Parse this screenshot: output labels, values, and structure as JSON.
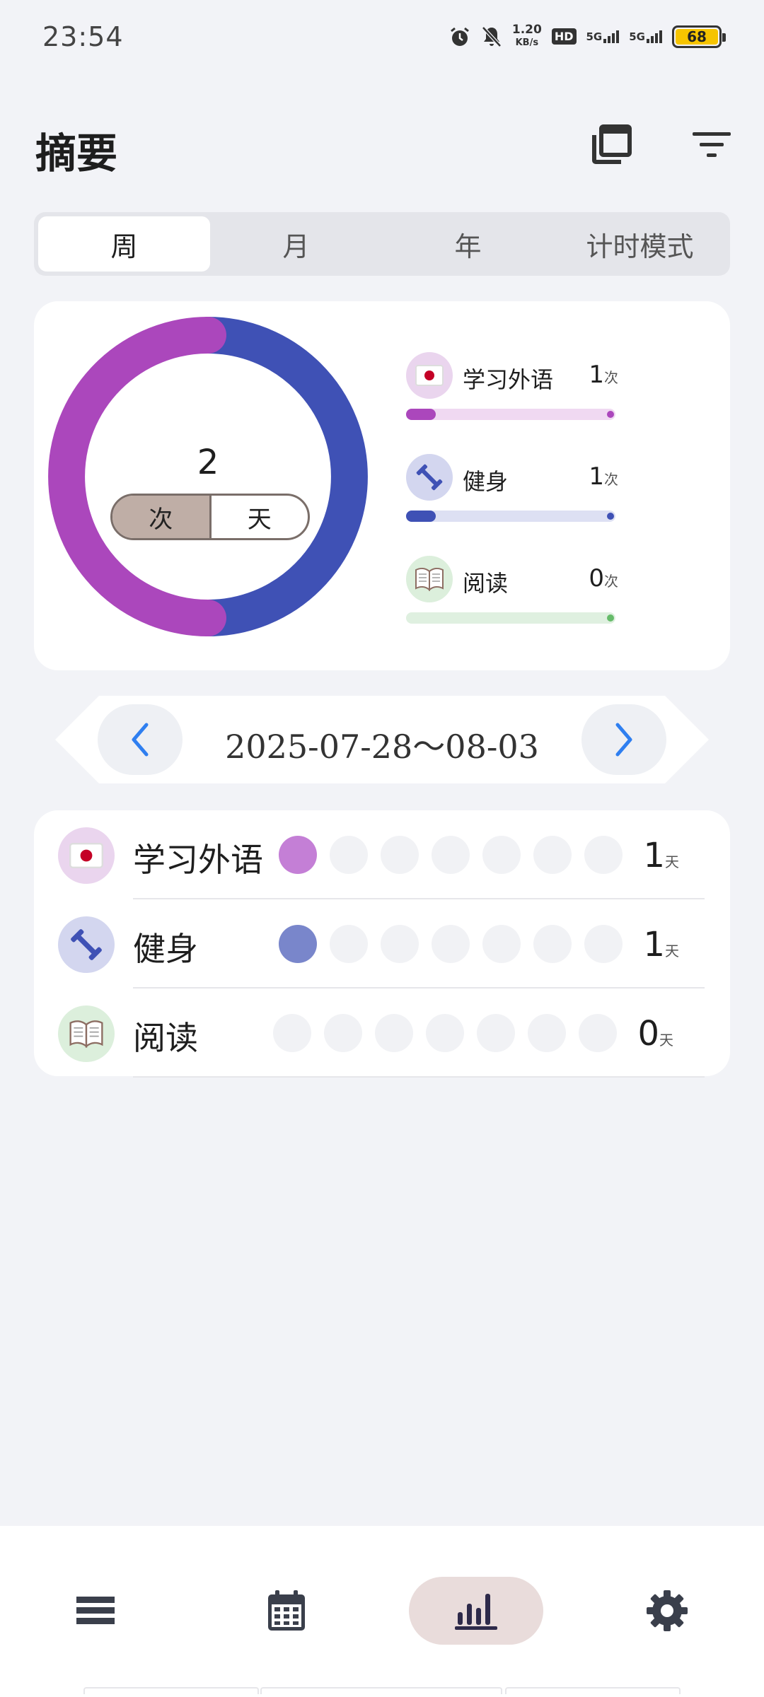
{
  "status_bar": {
    "time": "23:54",
    "speed_value": "1.20",
    "speed_unit": "KB/s",
    "hd_label": "HD",
    "net1": "5G",
    "net2": "5G",
    "battery": "68",
    "battery_color": "#f6c400",
    "icons": [
      "alarm-icon",
      "mute-icon",
      "hd-icon",
      "signal-icon",
      "signal-icon",
      "battery-icon"
    ]
  },
  "header": {
    "title": "摘要",
    "icons": [
      "copy-icon",
      "filter-icon"
    ]
  },
  "tabs": [
    {
      "label": "周",
      "active": true
    },
    {
      "label": "月",
      "active": false
    },
    {
      "label": "年",
      "active": false
    },
    {
      "label": "计时模式",
      "active": false
    }
  ],
  "summary": {
    "total": "2",
    "unit_options": [
      {
        "label": "次",
        "selected": true
      },
      {
        "label": "天",
        "selected": false
      }
    ],
    "habits": [
      {
        "name": "学习外语",
        "count": "1",
        "unit": "次",
        "color": "#ab47bc",
        "light_color": "#f0d9f2",
        "icon": "japan-flag-icon"
      },
      {
        "name": "健身",
        "count": "1",
        "unit": "次",
        "color": "#3f51b5",
        "light_color": "#dde0f3",
        "icon": "dumbbell-icon"
      },
      {
        "name": "阅读",
        "count": "0",
        "unit": "次",
        "color": "#66bb6a",
        "light_color": "#dff0e0",
        "icon": "book-icon"
      }
    ]
  },
  "date_nav": {
    "range": "2025-07-28～08-03",
    "icons": [
      "chevron-left-icon",
      "chevron-right-icon"
    ],
    "accent": "#2f7ff0"
  },
  "week_list": [
    {
      "name": "学习外语",
      "days_done": [
        true,
        false,
        false,
        false,
        false,
        false,
        false
      ],
      "count": "1",
      "unit": "天",
      "dot_color": "#c47fd6"
    },
    {
      "name": "健身",
      "days_done": [
        true,
        false,
        false,
        false,
        false,
        false,
        false
      ],
      "count": "1",
      "unit": "天",
      "dot_color": "#7986cb"
    },
    {
      "name": "阅读",
      "days_done": [
        false,
        false,
        false,
        false,
        false,
        false,
        false
      ],
      "count": "0",
      "unit": "天",
      "dot_color": "#81c784"
    }
  ],
  "bottom_nav": [
    {
      "icon": "list-icon",
      "active": false
    },
    {
      "icon": "calendar-icon",
      "active": false
    },
    {
      "icon": "bar-chart-icon",
      "active": true
    },
    {
      "icon": "gear-icon",
      "active": false
    }
  ]
}
